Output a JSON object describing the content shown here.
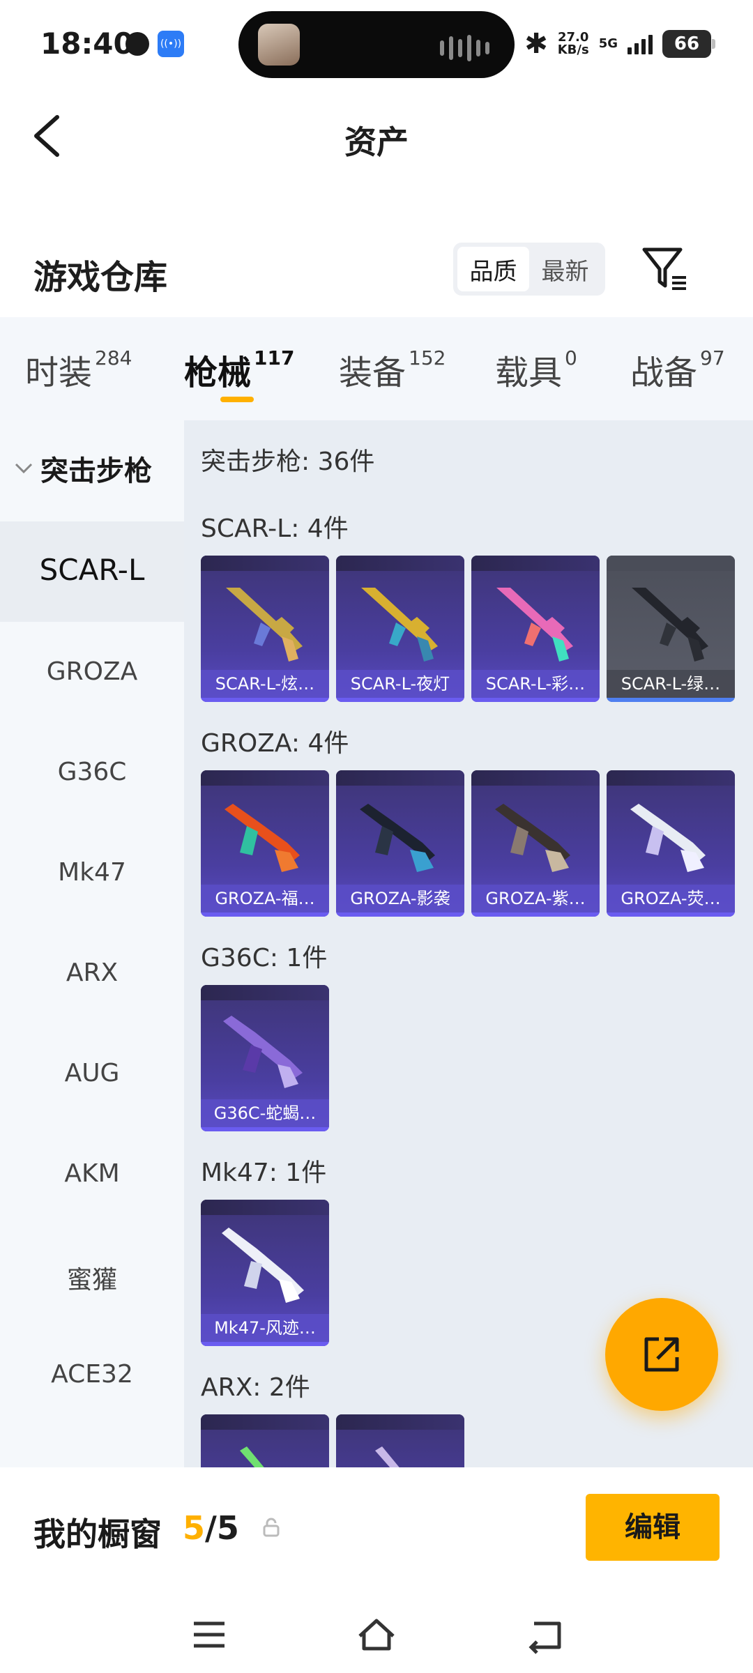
{
  "status_bar": {
    "time": "18:40",
    "speed_value": "27.0",
    "speed_unit": "KB/s",
    "network": "5G",
    "battery": "66"
  },
  "header": {
    "title": "资产"
  },
  "section": {
    "title": "游戏仓库",
    "sort_options": [
      "品质",
      "最新"
    ],
    "selected_sort": "品质"
  },
  "tabs": [
    {
      "label": "时装",
      "count": "284"
    },
    {
      "label": "枪械",
      "count": "117"
    },
    {
      "label": "装备",
      "count": "152"
    },
    {
      "label": "载具",
      "count": "0"
    },
    {
      "label": "战备",
      "count": "97"
    }
  ],
  "sidebar": {
    "category": "突击步枪",
    "items": [
      "SCAR-L",
      "GROZA",
      "G36C",
      "Mk47",
      "ARX",
      "AUG",
      "AKM",
      "蜜獾",
      "ACE32"
    ],
    "selected": "SCAR-L"
  },
  "content": {
    "total": "突击步枪: 36件",
    "groups": [
      {
        "label": "SCAR-L: 4件",
        "items": [
          "SCAR-L-炫…",
          "SCAR-L-夜灯",
          "SCAR-L-彩…",
          "SCAR-L-绿…"
        ]
      },
      {
        "label": "GROZA: 4件",
        "items": [
          "GROZA-福…",
          "GROZA-影袭",
          "GROZA-紫…",
          "GROZA-荧…"
        ]
      },
      {
        "label": "G36C: 1件",
        "items": [
          "G36C-蛇蝎…"
        ]
      },
      {
        "label": "Mk47: 1件",
        "items": [
          "Mk47-风迹…"
        ]
      },
      {
        "label": "ARX: 2件",
        "items": []
      }
    ]
  },
  "showcase": {
    "label": "我的橱窗",
    "used": "5",
    "separator": "/",
    "total": "5",
    "edit_label": "编辑"
  },
  "colors": {
    "accent": "#ffb000",
    "card_purple": "#4a3ea0",
    "tab_bg": "#f4f7fb",
    "content_bg": "#e8edf3"
  },
  "icons": [
    "back-arrow-icon",
    "filter-icon",
    "chevron-down-icon",
    "share-export-icon",
    "lock-icon",
    "menu-icon",
    "home-icon",
    "back-nav-icon"
  ]
}
